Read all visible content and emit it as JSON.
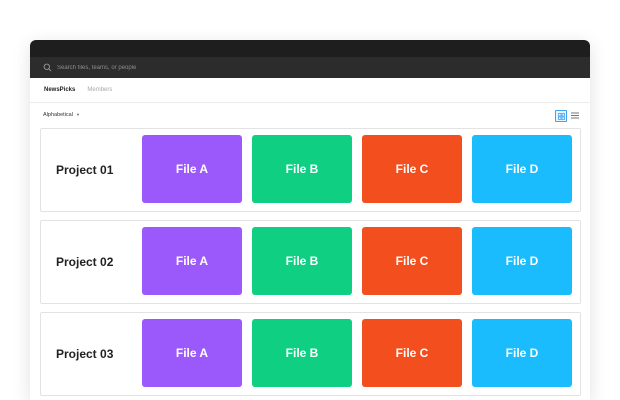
{
  "search": {
    "placeholder": "Search files, teams, or people"
  },
  "tabs": [
    {
      "label": "NewsPicks",
      "active": true
    },
    {
      "label": "Members",
      "active": false
    }
  ],
  "toolbar": {
    "sort_label": "Alphabetical",
    "active_view": "grid"
  },
  "projects": [
    {
      "name": "Project 01",
      "files": [
        {
          "label": "File A"
        },
        {
          "label": "File B"
        },
        {
          "label": "File C"
        },
        {
          "label": "File D"
        }
      ]
    },
    {
      "name": "Project 02",
      "files": [
        {
          "label": "File A"
        },
        {
          "label": "File B"
        },
        {
          "label": "File C"
        },
        {
          "label": "File D"
        }
      ]
    },
    {
      "name": "Project 03",
      "files": [
        {
          "label": "File A"
        },
        {
          "label": "File B"
        },
        {
          "label": "File C"
        },
        {
          "label": "File D"
        }
      ]
    }
  ],
  "colors": {
    "file_a": "#9b59fb",
    "file_b": "#0fcf83",
    "file_c": "#f24e1e",
    "file_d": "#1abcfe",
    "accent": "#3da5f4"
  },
  "icons": {
    "search": "search-icon",
    "grid_view": "grid-view-icon",
    "list_view": "list-view-icon",
    "sort_caret": "chevron-down-icon"
  }
}
